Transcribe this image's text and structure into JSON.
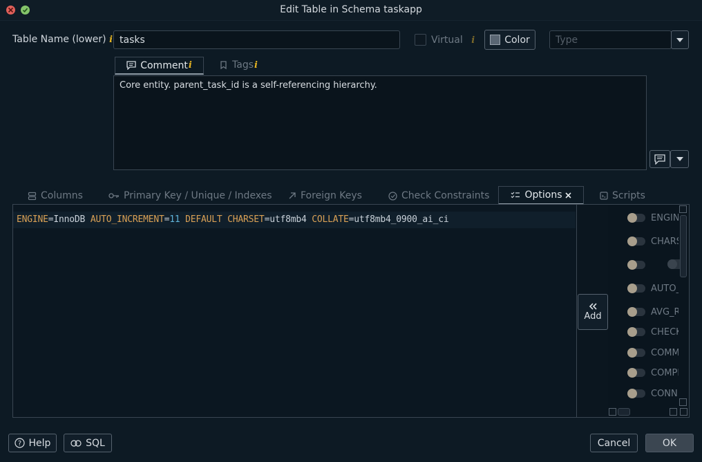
{
  "window": {
    "title": "Edit Table in Schema taskapp"
  },
  "table_name": {
    "label": "Table Name (lower)",
    "value": "tasks"
  },
  "virtual": {
    "label": "Virtual",
    "checked": false
  },
  "color_button": {
    "label": "Color"
  },
  "type_select": {
    "placeholder": "Type"
  },
  "comment_tabs": [
    {
      "label": "Comment",
      "active": true
    },
    {
      "label": "Tags",
      "active": false
    }
  ],
  "comment_text": "Core entity. parent_task_id is a self-referencing hierarchy.",
  "main_tabs": [
    {
      "label": "Columns",
      "icon": "columns-icon"
    },
    {
      "label": "Primary Key / Unique / Indexes",
      "icon": "key-icon"
    },
    {
      "label": "Foreign Keys",
      "icon": "arrow-up-right-icon"
    },
    {
      "label": "Check Constraints",
      "icon": "check-circle-icon"
    },
    {
      "label": "Options",
      "icon": "checklist-icon",
      "active": true
    },
    {
      "label": "Scripts",
      "icon": "script-icon"
    }
  ],
  "options_code": {
    "engine_kw": "ENGINE",
    "engine_val": "InnoDB",
    "autoinc_kw": "AUTO_INCREMENT",
    "autoinc_val": "11",
    "default_kw": "DEFAULT",
    "charset_kw": "CHARSET",
    "charset_val": "utf8mb4",
    "collate_kw": "COLLATE",
    "collate_val": "utf8mb4_0900_ai_ci"
  },
  "add_button": {
    "label": "Add"
  },
  "options_list": [
    {
      "name": "ENGINE"
    },
    {
      "name": "CHARSET"
    },
    {
      "name": ""
    },
    {
      "name": "AUTO_INCREMENT"
    },
    {
      "name": "AVG_ROW_LENGTH"
    },
    {
      "name": "CHECKSUM"
    },
    {
      "name": "COMMENT"
    },
    {
      "name": "COMPRESSION"
    },
    {
      "name": "CONNECTION"
    }
  ],
  "footer": {
    "help": "Help",
    "sql": "SQL",
    "cancel": "Cancel",
    "ok": "OK"
  }
}
